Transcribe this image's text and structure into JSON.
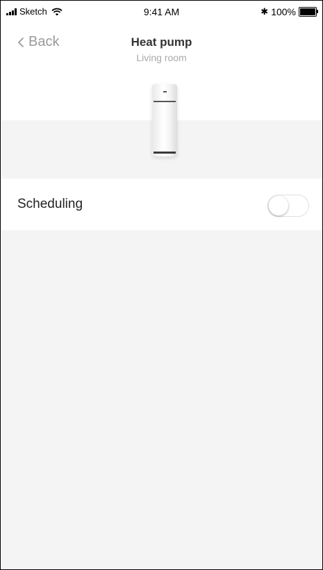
{
  "status_bar": {
    "carrier": "Sketch",
    "time": "9:41 AM",
    "battery": "100%"
  },
  "nav": {
    "back_label": "Back",
    "title": "Heat pump",
    "subtitle": "Living room"
  },
  "settings": {
    "scheduling_label": "Scheduling",
    "scheduling_enabled": false
  },
  "icons": {
    "signal": "signal-icon",
    "wifi": "wifi-icon",
    "bluetooth": "bluetooth-icon",
    "battery": "battery-icon",
    "back": "chevron-left-icon"
  },
  "colors": {
    "background": "#f4f4f4",
    "surface": "#ffffff",
    "back_text": "#9a9a9a",
    "subtitle_text": "#a9a9a9"
  }
}
